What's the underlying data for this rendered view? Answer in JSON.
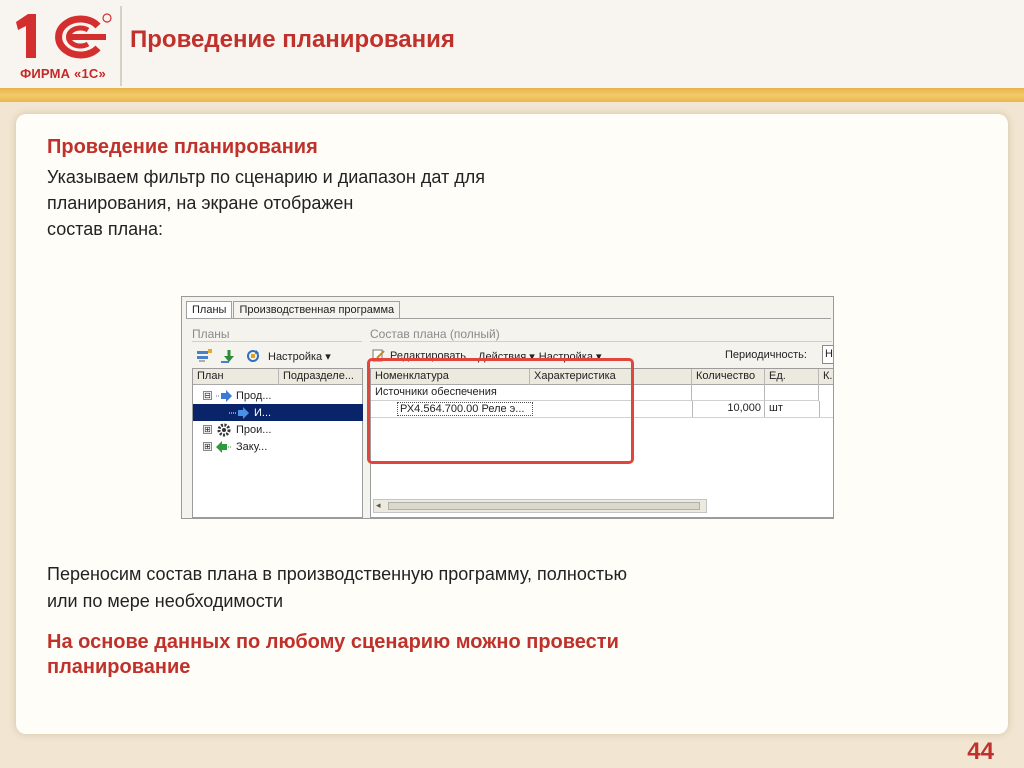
{
  "header": {
    "logo_text": "ФИРМА «1С»",
    "title": "Проведение планирования"
  },
  "content": {
    "subtitle": "Проведение планирования",
    "intro_lines": [
      "Указываем фильтр по сценарию и диапазон дат для",
      "планирования, на экране отображен",
      "состав плана:"
    ],
    "para2_lines": [
      "Переносим состав плана в производственную программу, полностью",
      "или по мере необходимости"
    ],
    "conclusion_lines": [
      "На основе данных по любому сценарию можно провести",
      "планирование"
    ],
    "page_number": "44"
  },
  "app": {
    "tabs": [
      {
        "label": "Планы",
        "active": true
      },
      {
        "label": "Производственная программа",
        "active": false
      }
    ],
    "left_panel": {
      "title": "Планы",
      "toolbar": {
        "settings_label": "Настройка ▾"
      },
      "columns": [
        "План",
        "Подразделе..."
      ],
      "tree": [
        {
          "label": "Прод...",
          "expander": "⊟",
          "icon": "arrow-right-icon",
          "indent": 0,
          "selected": false
        },
        {
          "label": "И...",
          "expander": "",
          "icon": "arrow-right-icon",
          "indent": 1,
          "selected": true
        },
        {
          "label": "Прои...",
          "expander": "⊞",
          "icon": "gear-icon",
          "indent": 0,
          "selected": false
        },
        {
          "label": "Заку...",
          "expander": "⊞",
          "icon": "arrow-left-icon",
          "indent": 0,
          "selected": false
        }
      ]
    },
    "right_panel": {
      "title": "Состав плана (полный)",
      "toolbar": {
        "edit_label": "Редактировать",
        "actions_label": "Действия ▾",
        "settings_label": "Настройка ▾",
        "periodicity_label": "Периодичность:",
        "periodicity_value": "Н"
      },
      "columns": [
        "Номенклатура",
        "Характеристика",
        "Количество",
        "Ед.",
        "К."
      ],
      "group_row": "Источники обеспечения",
      "data_row": {
        "item": "РХ4.564.700.00 Реле э...",
        "quantity": "10,000",
        "unit": "шт"
      }
    }
  },
  "colors": {
    "accent": "#c0312b",
    "stripe": "#f3cc6a",
    "highlight_box": "#e2453b",
    "selection": "#0a246a"
  }
}
